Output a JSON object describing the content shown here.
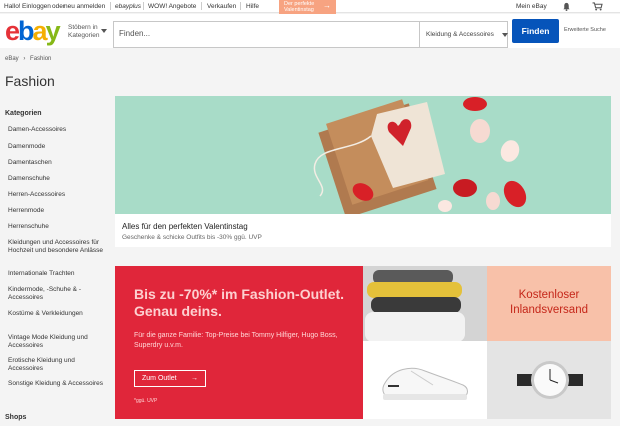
{
  "topbar": {
    "greeting": "Hallo!",
    "login": "Einloggen",
    "or": "oder",
    "register": "neu anmelden",
    "ebay_plus": "ebayplus",
    "wow": "WOW! Angebote",
    "sell": "Verkaufen",
    "help": "Hilfe",
    "promo_line1": "Der perfekte",
    "promo_line2": "Valentinstag",
    "my_ebay": "Mein eBay"
  },
  "header": {
    "logo_letters": [
      "e",
      "b",
      "a",
      "y"
    ],
    "browse_line1": "Stöbern in",
    "browse_line2": "Kategorien",
    "search_placeholder": "Finden...",
    "category": "Kleidung & Accessoires",
    "search_button": "Finden",
    "advanced": "Erweiterte Suche"
  },
  "breadcrumb": {
    "home": "eBay",
    "separator": "›",
    "current": "Fashion"
  },
  "page_title": "Fashion",
  "sidebar": {
    "heading": "Kategorien",
    "items": [
      "Damen-Accessoires",
      "Damenmode",
      "Damentaschen",
      "Damenschuhe",
      "Herren-Accessoires",
      "Herrenmode",
      "Herrenschuhe",
      "Kleidungen und Accessoires für Hochzeit und besondere Anlässe",
      "Internationale Trachten",
      "Kindermode, -Schuhe & -Accessoires",
      "Kostüme & Verkleidungen",
      "Vintage Mode Kleidung und Accessoires",
      "Erotische Kleidung und Accessoires",
      "Sonstige Kleidung & Accessoires"
    ],
    "shops_heading": "Shops"
  },
  "hero": {
    "title": "Alles für den perfekten Valentinstag",
    "subtitle": "Geschenke & schicke Outfits bis -30% ggü. UVP"
  },
  "outlet": {
    "headline": "Bis zu -70%* im Fashion-Outlet. Genau deins.",
    "subline": "Für die ganze Familie: Top-Preise bei Tommy Hilfiger, Hugo Boss, Superdry u.v.m.",
    "button": "Zum Outlet",
    "footnote": "*ggü. UVP"
  },
  "shipping": {
    "line1": "Kostenloser",
    "line2": "Inlandsversand"
  },
  "colors": {
    "logo_e": "#e53238",
    "logo_b": "#0064d2",
    "logo_a": "#f5af02",
    "logo_y": "#86b817",
    "primary": "#0654ba",
    "outlet_red": "#e0263a",
    "shipping_bg": "#f8c1a9",
    "hero_bg": "#a8dcc8"
  },
  "icons": [
    "bell-icon",
    "cart-icon",
    "chevron-down-icon",
    "arrow-right-icon"
  ]
}
